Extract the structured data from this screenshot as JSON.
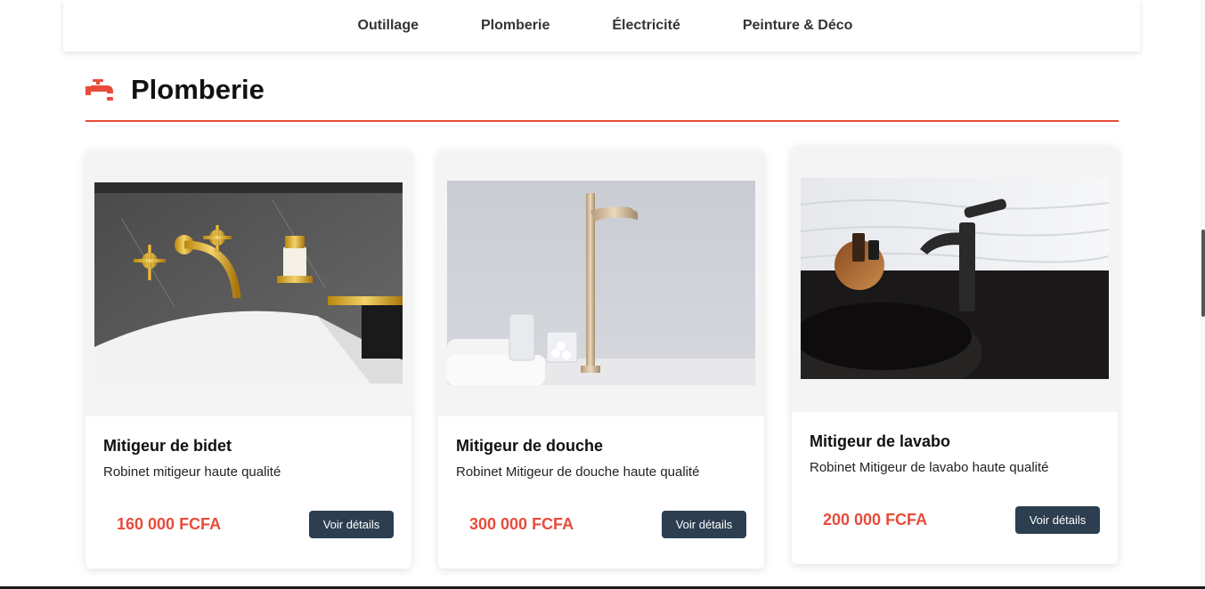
{
  "nav": {
    "items": [
      {
        "label": "Outillage"
      },
      {
        "label": "Plomberie"
      },
      {
        "label": "Électricité"
      },
      {
        "label": "Peinture & Déco"
      }
    ]
  },
  "section": {
    "title": "Plomberie",
    "icon": "faucet-icon",
    "accent_color": "#e74c3c"
  },
  "products": [
    {
      "name": "Mitigeur de bidet",
      "description": "Robinet mitigeur haute qualité",
      "price": "160 000 FCFA",
      "button_label": "Voir détails",
      "image": "gold-wall-mixer-photo"
    },
    {
      "name": "Mitigeur de douche",
      "description": "Robinet Mitigeur de douche haute qualité",
      "price": "300 000 FCFA",
      "button_label": "Voir détails",
      "image": "champagne-tall-faucet-photo"
    },
    {
      "name": "Mitigeur de lavabo",
      "description": "Robinet Mitigeur de lavabo haute qualité",
      "price": "200 000 FCFA",
      "button_label": "Voir détails",
      "image": "black-basin-mixer-photo"
    }
  ],
  "colors": {
    "button_bg": "#2c3e50",
    "price": "#e74c3c"
  }
}
